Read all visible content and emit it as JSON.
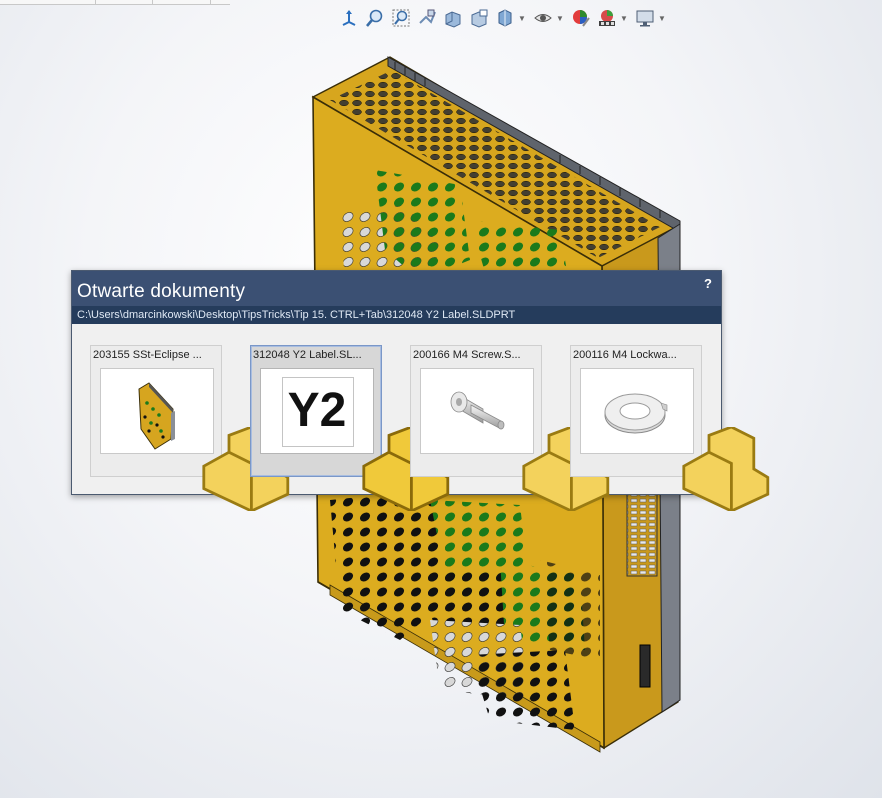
{
  "toolbar": {
    "buttons": [
      {
        "icon": "view-orientation-icon"
      },
      {
        "icon": "zoom-to-fit-icon"
      },
      {
        "icon": "zoom-to-area-icon"
      },
      {
        "icon": "previous-view-icon"
      },
      {
        "icon": "section-view-icon"
      },
      {
        "icon": "dynamic-annotation-icon"
      },
      {
        "icon": "view-orientation-cube-icon"
      },
      {
        "icon": "display-style-icon"
      },
      {
        "icon": "hide-show-items-icon"
      },
      {
        "icon": "edit-appearance-icon"
      },
      {
        "icon": "apply-scene-icon"
      },
      {
        "icon": "view-settings-icon"
      }
    ]
  },
  "dialog": {
    "title": "Otwarte dokumenty",
    "help_label": "?",
    "path": "C:\\Users\\dmarcinkowski\\Desktop\\TipsTricks\\Tip 15. CTRL+Tab\\312048 Y2 Label.SLDPRT",
    "documents": [
      {
        "title": "203155 SSt-Eclipse ...",
        "preview": "enclosure-assembly",
        "selected": false
      },
      {
        "title": "312048 Y2 Label.SL...",
        "preview": "label",
        "label_text": "Y2",
        "selected": true
      },
      {
        "title": "200166 M4 Screw.S...",
        "preview": "screw",
        "selected": false
      },
      {
        "title": "200116 M4 Lockwa...",
        "preview": "lockwasher",
        "selected": false
      }
    ]
  },
  "colors": {
    "title_bar": "#3b5073",
    "path_bar": "#253c5c",
    "model_yellow": "#d9a81f",
    "hole_green": "#1b7a1b"
  }
}
